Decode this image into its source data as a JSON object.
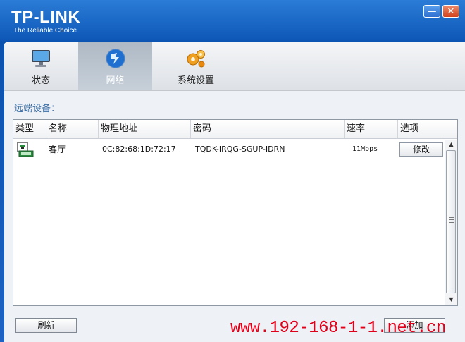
{
  "window": {
    "logo": {
      "brand": "TP-LINK",
      "tagline": "The Reliable Choice"
    },
    "controls": {
      "minimize": "—",
      "close": "✕"
    }
  },
  "tabs": [
    {
      "label": "状态",
      "icon": "monitor-icon",
      "selected": false
    },
    {
      "label": "网络",
      "icon": "network-globe-icon",
      "selected": true
    },
    {
      "label": "系统设置",
      "icon": "gears-icon",
      "selected": false
    }
  ],
  "section_title": "远端设备：",
  "table": {
    "columns": [
      "类型",
      "名称",
      "物理地址",
      "密码",
      "速率",
      "选项"
    ],
    "rows": [
      {
        "type_icon": "powerline-adapter-icon",
        "name": "客厅",
        "mac": "0C:82:68:1D:72:17",
        "password": "TQDK-IRQG-SGUP-IDRN",
        "speed": "11Mbps",
        "action": "修改"
      }
    ]
  },
  "buttons": {
    "refresh": "刷新",
    "add": "添加"
  },
  "watermark": "www.192-168-1-1.net.cn",
  "colors": {
    "title_bar": "#0f59b9",
    "section_title": "#3a6ea5",
    "watermark": "#e0001a"
  }
}
